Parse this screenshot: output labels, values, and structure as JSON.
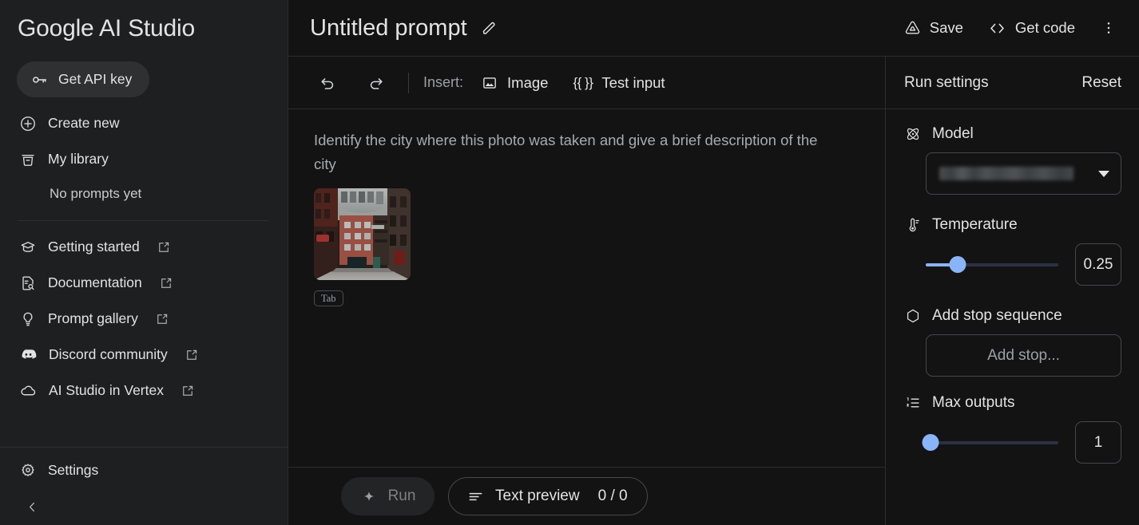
{
  "sidebar": {
    "brand": "Google AI Studio",
    "api_key_button": {
      "label": "Get API key",
      "icon": "key-icon"
    },
    "items": [
      {
        "label": "Create new",
        "icon": "plus-circle-icon",
        "external": false
      },
      {
        "label": "My library",
        "icon": "library-icon",
        "external": false
      }
    ],
    "empty_state": "No prompts yet",
    "links": [
      {
        "label": "Getting started",
        "icon": "graduation-cap-icon",
        "external": true
      },
      {
        "label": "Documentation",
        "icon": "document-search-icon",
        "external": true
      },
      {
        "label": "Prompt gallery",
        "icon": "lightbulb-icon",
        "external": true
      },
      {
        "label": "Discord community",
        "icon": "discord-icon",
        "external": true
      },
      {
        "label": "AI Studio in Vertex",
        "icon": "cloud-icon",
        "external": true
      }
    ],
    "settings": {
      "label": "Settings",
      "icon": "gear-icon"
    },
    "collapse": {
      "icon": "chevron-left-icon"
    }
  },
  "header": {
    "title": "Untitled prompt",
    "edit_icon": "pencil-icon",
    "save": {
      "label": "Save",
      "icon": "drive-save-icon"
    },
    "get_code": {
      "label": "Get code",
      "icon": "code-brackets-icon"
    },
    "more_icon": "kebab-menu-icon"
  },
  "toolbar": {
    "undo_icon": "undo-icon",
    "redo_icon": "redo-icon",
    "insert_label": "Insert:",
    "image_button": {
      "label": "Image",
      "icon": "image-icon"
    },
    "test_input_button": {
      "label": "Test input",
      "icon": "double-braces-icon"
    }
  },
  "editor": {
    "prompt_text": "Identify the city where this photo was taken and give a brief description of the city",
    "attachment": {
      "name": "photo-thumbnail",
      "alt": "narrow city alley with red brick buildings"
    },
    "tab_chip": "Tab"
  },
  "bottom": {
    "run_button": {
      "label": "Run",
      "icon": "sparkle-icon"
    },
    "text_preview": {
      "label": "Text preview",
      "count": "0 / 0",
      "icon": "text-lines-icon"
    }
  },
  "run_settings": {
    "title": "Run settings",
    "reset_label": "Reset",
    "model": {
      "label": "Model",
      "icon": "atom-icon",
      "value": "",
      "redacted": true
    },
    "temperature": {
      "label": "Temperature",
      "icon": "thermometer-icon",
      "value": "0.25",
      "min": 0,
      "max": 2,
      "fill_percent": 24
    },
    "stop_sequence": {
      "label": "Add stop sequence",
      "icon": "hexagon-icon",
      "placeholder": "Add stop..."
    },
    "max_outputs": {
      "label": "Max outputs",
      "icon": "numbered-list-icon",
      "value": "1",
      "min": 1,
      "max": 8,
      "fill_percent": 0
    }
  },
  "colors": {
    "background": "#131314",
    "sidebar_background": "#1e1f20",
    "accent": "#8ab4f8",
    "text_primary": "#e3e3e3",
    "text_secondary": "#9aa0a6",
    "border": "#2b2c2e"
  }
}
